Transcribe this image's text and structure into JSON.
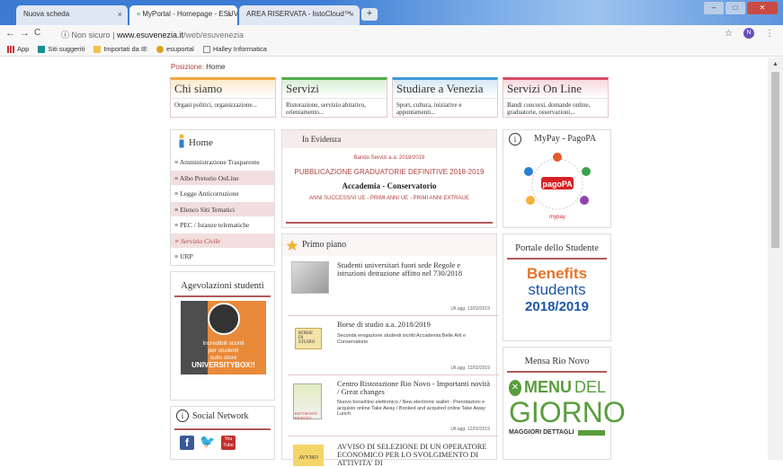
{
  "browser": {
    "tabs": [
      {
        "label": "Nuova scheda"
      },
      {
        "label": "MyPortal - Homepage - ESUVen"
      },
      {
        "label": "AREA RISERVATA - listoCloud™"
      }
    ],
    "new_tab": "+",
    "close": "×",
    "nav": {
      "back": "←",
      "forward": "→",
      "reload": "C",
      "info": "ⓘ"
    },
    "url_prefix": "Non sicuro",
    "url_separator": "|",
    "url_domain": "www.esuvenezia.it",
    "url_path": "/web/esuvenezia",
    "star": "☆",
    "avatar_letter": "N",
    "menu": "⋮",
    "bookmarks": [
      "App",
      "Siti suggeriti",
      "Importati da IE",
      "esuportal",
      "Halley Informatica"
    ]
  },
  "breadcrumb": {
    "label": "Posizione:",
    "current": "Home"
  },
  "top_tabs": [
    {
      "title": "Chi siamo",
      "desc": "Organi politici, organizzazione...",
      "color": "#f2a640"
    },
    {
      "title": "Servizi",
      "desc": "Ristorazione, servizio abitativo, orientamento...",
      "color": "#4fae4a"
    },
    {
      "title": "Studiare a Venezia",
      "desc": "Sport, cultura, iniziative e appuntamenti...",
      "color": "#3d9ad8"
    },
    {
      "title": "Servizi On Line",
      "desc": "Bandi concorsi, domande online, graduatorie, osservazioni...",
      "color": "#d94b6b"
    }
  ],
  "menu": {
    "title": "Home",
    "items": [
      {
        "label": "Amministrazione Trasparente",
        "style": "white"
      },
      {
        "label": "Albo Pretorio OnLine",
        "style": "pink"
      },
      {
        "label": "Legge Anticorruzione",
        "style": "white"
      },
      {
        "label": "Elenco Siti Tematici",
        "style": "pink"
      },
      {
        "label": "PEC / Istanze telematiche",
        "style": "white"
      },
      {
        "label": "Servizio Civile",
        "style": "pink-sel"
      },
      {
        "label": "URP",
        "style": "white"
      }
    ]
  },
  "in_evidenza": {
    "title": "In Evidenza",
    "line1": "Bando Servizi a.a. 2018/2019",
    "line2": "PUBBLICAZIONE GRADUATORIE DEFINITIVE 2018-2019",
    "line3": "Accademia - Conservatorio",
    "line4": "ANNI SUCCESSIVI UE - PRIMI ANNI UE - PRIMI ANNI EXTRAUE"
  },
  "mypay": {
    "title": "MyPay - PagoPA",
    "logo_text": "pagoPA",
    "sub": "mypay"
  },
  "primo_piano": {
    "title": "Primo piano",
    "news": [
      {
        "title": "Studenti universitari fuori sede Regole e istruzioni detrazione affitto nel 730/2018",
        "desc": "",
        "updated": "Ult.agg. 13/02/2019"
      },
      {
        "title": "Borse di studio a.a. 2018/2019",
        "desc": "Seconda erogazione studenti iscritti Accademia Belle Arti e Conservatorio",
        "updated": "Ult.agg. 13/02/2019",
        "thumb_text": "BORSE DI STUDIO"
      },
      {
        "title": "Centro Ristorazione Rio Novo - Importanti novità / Great changes",
        "desc": "Nuovo borsellino elettronico / New electronic wallet - Prenotazioni e acquisto online Take Away / Booked and acquired online Take Away Lunch",
        "updated": "Ult.agg. 12/02/2019",
        "thumb_text": "RISTORANTE RIONOVO"
      },
      {
        "title": "AVVISO DI SELEZIONE DI UN OPERATORE ECONOMICO PER LO SVOLGIMENTO DI ATTIVITA' DI",
        "desc": "",
        "updated": "",
        "thumb_text": "AVVISO"
      }
    ]
  },
  "agevolazioni": {
    "title": "Agevolazioni studenti",
    "promo_line1": "Incredibili sconti",
    "promo_line2": "per studenti",
    "promo_line3": "sullo store",
    "promo_brand": "UNIVERSITYBOX!!"
  },
  "social": {
    "title": "Social Network",
    "icons": [
      "facebook-icon",
      "twitter-icon",
      "youtube-icon"
    ],
    "youtube_text": "You Tube"
  },
  "portale": {
    "title": "Portale dello Studente",
    "word1": "Benefits",
    "word2": "students",
    "year": "2018/2019"
  },
  "mensa": {
    "title": "Mensa Rio Novo",
    "menu_word": "MENU",
    "del_word": "DEL",
    "giorno_word": "GIORNO",
    "details": "MAGGIORI DETTAGLI"
  }
}
